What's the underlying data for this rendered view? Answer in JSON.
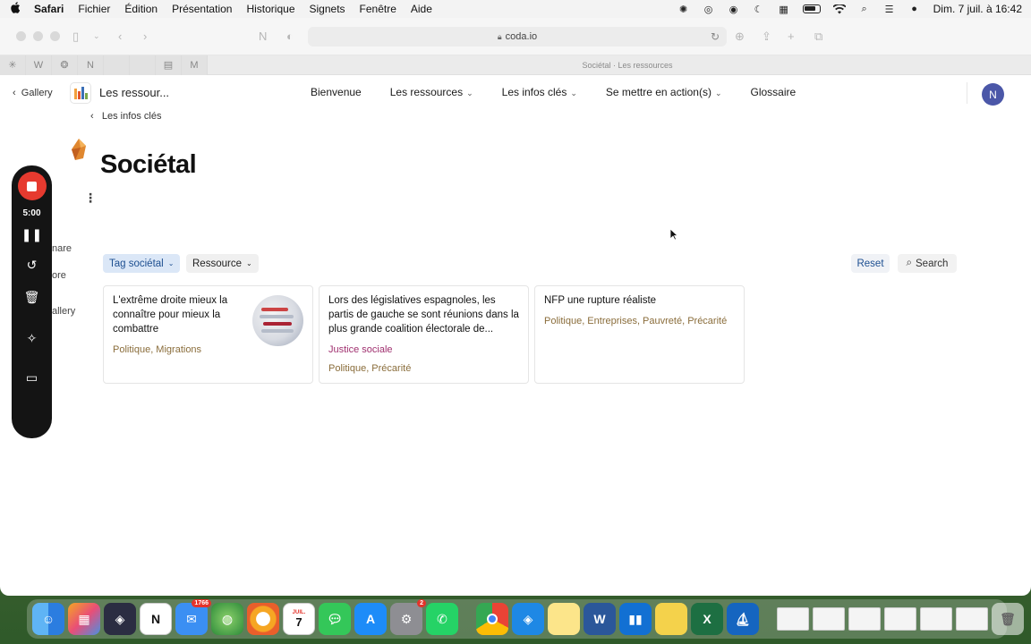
{
  "menubar": {
    "apple": "",
    "items": [
      "Safari",
      "Fichier",
      "Édition",
      "Présentation",
      "Historique",
      "Signets",
      "Fenêtre",
      "Aide"
    ],
    "datetime": "Dim. 7 juil. à 16:42"
  },
  "browser": {
    "url": "coda.io",
    "tab_title": "Sociétal · Les ressources"
  },
  "doc": {
    "gallery_label": "Gallery",
    "title": "Les ressour...",
    "nav": {
      "bienvenue": "Bienvenue",
      "ressources": "Les ressources",
      "infos": "Les infos clés",
      "action": "Se mettre en action(s)",
      "glossaire": "Glossaire"
    },
    "avatar_initial": "N"
  },
  "page": {
    "breadcrumb": "Les infos clés",
    "title": "Sociétal",
    "side_fragments": [
      "nare",
      "ore",
      "allery"
    ]
  },
  "recorder": {
    "time": "5:00"
  },
  "filters": {
    "tag": "Tag sociétal",
    "resource": "Ressource",
    "reset": "Reset",
    "search": "Search"
  },
  "cards": [
    {
      "title": "L'extrême droite mieux la connaître pour mieux la combattre",
      "tags": "Politique, Migrations"
    },
    {
      "title": "Lors des législatives espagnoles, les partis de gauche se sont réunions dans la plus grande coalition électorale de...",
      "category": "Justice sociale",
      "tags": "Politique, Précarité"
    },
    {
      "title": "NFP une rupture réaliste",
      "tags": "Politique, Entreprises, Pauvreté, Précarité"
    }
  ],
  "dock": {
    "mail_badge": "1766",
    "settings_badge": "2",
    "calendar_month": "JUIL.",
    "calendar_day": "7",
    "notion_letter": "N",
    "word_letter": "W",
    "excel_letter": "X"
  },
  "colors": {
    "accent_blue": "#1d4f91",
    "tag_bg": "#dbe7f7",
    "tag_text_brown": "#8a6d3b",
    "tag_text_magenta": "#a0306f",
    "record_red": "#e63a2f",
    "avatar": "#4b57a8"
  }
}
